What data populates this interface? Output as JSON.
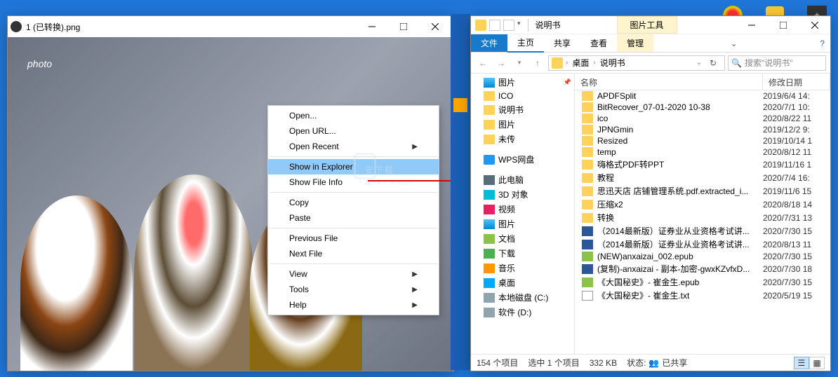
{
  "viewer": {
    "title": "1 (已转换).png",
    "logo": "photo"
  },
  "contextMenu": {
    "items": [
      {
        "label": "Open...",
        "sub": false
      },
      {
        "label": "Open URL...",
        "sub": false
      },
      {
        "label": "Open Recent",
        "sub": true
      },
      null,
      {
        "label": "Show in Explorer",
        "sub": false,
        "hl": true
      },
      {
        "label": "Show File Info",
        "sub": false
      },
      null,
      {
        "label": "Copy",
        "sub": false
      },
      {
        "label": "Paste",
        "sub": false
      },
      null,
      {
        "label": "Previous File",
        "sub": false
      },
      {
        "label": "Next File",
        "sub": false
      },
      null,
      {
        "label": "View",
        "sub": true
      },
      {
        "label": "Tools",
        "sub": true
      },
      {
        "label": "Help",
        "sub": true
      }
    ]
  },
  "watermark": {
    "main": "安下载",
    "sub": "anxz.com"
  },
  "explorer": {
    "titlebar": {
      "title": "说明书",
      "picTools": "图片工具"
    },
    "ribbon": {
      "file": "文件",
      "home": "主页",
      "share": "共享",
      "view": "查看",
      "manage": "管理"
    },
    "address": {
      "seg1": "桌面",
      "seg2": "说明书",
      "searchPlaceholder": "搜索\"说明书\""
    },
    "nav": [
      {
        "label": "图片",
        "ico": "ico-pic",
        "pinned": true
      },
      {
        "label": "ICO",
        "ico": "ico-folder"
      },
      {
        "label": "说明书",
        "ico": "ico-folder"
      },
      {
        "label": "图片",
        "ico": "ico-folder"
      },
      {
        "label": "未传",
        "ico": "ico-folder"
      },
      null,
      {
        "label": "WPS网盘",
        "ico": "ico-wps"
      },
      null,
      {
        "label": "此电脑",
        "ico": "ico-pc"
      },
      {
        "label": "3D 对象",
        "ico": "ico-3d"
      },
      {
        "label": "视频",
        "ico": "ico-video"
      },
      {
        "label": "图片",
        "ico": "ico-pic"
      },
      {
        "label": "文档",
        "ico": "ico-doc"
      },
      {
        "label": "下载",
        "ico": "ico-down"
      },
      {
        "label": "音乐",
        "ico": "ico-music"
      },
      {
        "label": "桌面",
        "ico": "ico-desk"
      },
      {
        "label": "本地磁盘 (C:)",
        "ico": "ico-disk"
      },
      {
        "label": "软件 (D:)",
        "ico": "ico-disk"
      }
    ],
    "columns": {
      "name": "名称",
      "date": "修改日期"
    },
    "files": [
      {
        "name": "APDFSplit",
        "date": "2019/6/4 14:",
        "ico": "ico-folder"
      },
      {
        "name": "BitRecover_07-01-2020 10-38",
        "date": "2020/7/1 10:",
        "ico": "ico-folder"
      },
      {
        "name": "ico",
        "date": "2020/8/22 11",
        "ico": "ico-folder"
      },
      {
        "name": "JPNGmin",
        "date": "2019/12/2 9:",
        "ico": "ico-folder"
      },
      {
        "name": "Resized",
        "date": "2019/10/14 1",
        "ico": "ico-folder"
      },
      {
        "name": "temp",
        "date": "2020/8/12 11",
        "ico": "ico-folder"
      },
      {
        "name": "嗨格式PDF转PPT",
        "date": "2019/11/16 1",
        "ico": "ico-folder"
      },
      {
        "name": "教程",
        "date": "2020/7/4 16:",
        "ico": "ico-folder"
      },
      {
        "name": "思迅天店 店铺管理系统.pdf.extracted_i...",
        "date": "2019/11/6 15",
        "ico": "ico-folder"
      },
      {
        "name": "压缩x2",
        "date": "2020/8/18 14",
        "ico": "ico-folder"
      },
      {
        "name": "转换",
        "date": "2020/7/31 13",
        "ico": "ico-folder"
      },
      {
        "name": "（2014最新版）证券业从业资格考试讲...",
        "date": "2020/7/30 15",
        "ico": "ico-word"
      },
      {
        "name": "（2014最新版）证券业从业资格考试讲...",
        "date": "2020/8/13 11",
        "ico": "ico-word"
      },
      {
        "name": "(NEW)anxaizai_002.epub",
        "date": "2020/7/30 15",
        "ico": "ico-epub"
      },
      {
        "name": "(复制)-anxaizai - 副本-加密-gwxKZvfxD...",
        "date": "2020/7/30 18",
        "ico": "ico-word"
      },
      {
        "name": "《大国秘史》- 崔金生.epub",
        "date": "2020/7/30 15",
        "ico": "ico-epub"
      },
      {
        "name": "《大国秘史》- 崔金生.txt",
        "date": "2020/5/19 15",
        "ico": "ico-txt"
      }
    ],
    "status": {
      "count": "154 个项目",
      "selected": "选中 1 个项目",
      "size": "332 KB",
      "stateLabel": "状态:",
      "shared": "已共享"
    }
  }
}
